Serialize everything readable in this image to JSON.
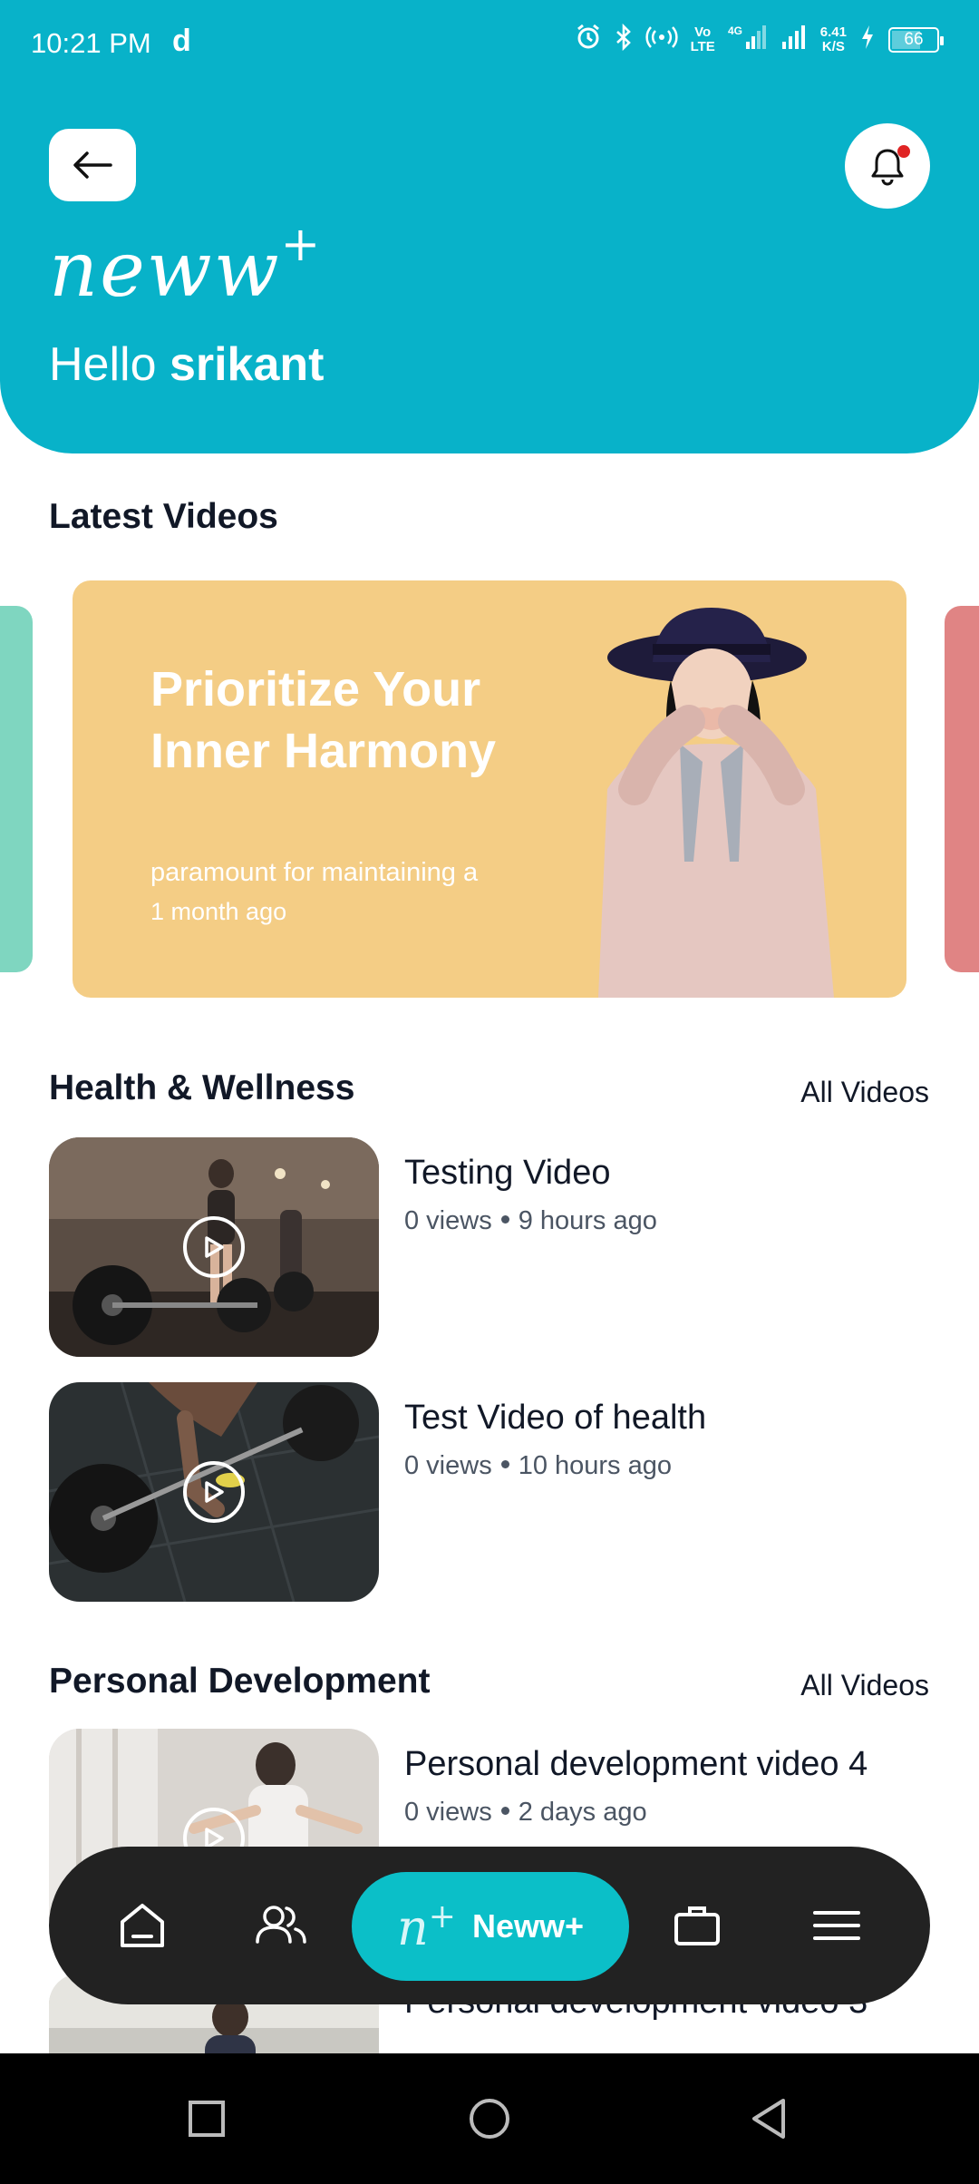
{
  "status_bar": {
    "time": "10:21 PM",
    "app_letter": "d",
    "volte": "Vo\nLTE",
    "network": "4G",
    "speed": "6.41\nK/S",
    "battery": "66"
  },
  "header": {
    "logo": "neww",
    "logo_plus": "+",
    "greeting_prefix": "Hello ",
    "user_name": "srikant",
    "accent_color": "#08b2c9"
  },
  "latest": {
    "title": "Latest Videos",
    "banner": {
      "title": "Prioritize Your Inner Harmony",
      "description": "paramount for maintaining a",
      "time": "1 month ago",
      "background": "#f4cd85"
    }
  },
  "health": {
    "title": "Health & Wellness",
    "all_videos": "All Videos",
    "videos": [
      {
        "title": "Testing Video",
        "views": "0 views",
        "time": "9 hours ago"
      },
      {
        "title": "Test Video of health",
        "views": "0 views",
        "time": "10 hours ago"
      }
    ]
  },
  "personal": {
    "title": "Personal Development",
    "all_videos": "All Videos",
    "videos": [
      {
        "title": "Personal development video 4",
        "views": "0 views",
        "time": "2 days ago"
      },
      {
        "title": "Personal development video 3"
      }
    ]
  },
  "bottom_nav": {
    "center_logo": "n",
    "center_plus": "+",
    "center_label": "Neww+",
    "items": [
      "home-icon",
      "people-icon",
      "briefcase-icon",
      "menu-icon"
    ]
  }
}
